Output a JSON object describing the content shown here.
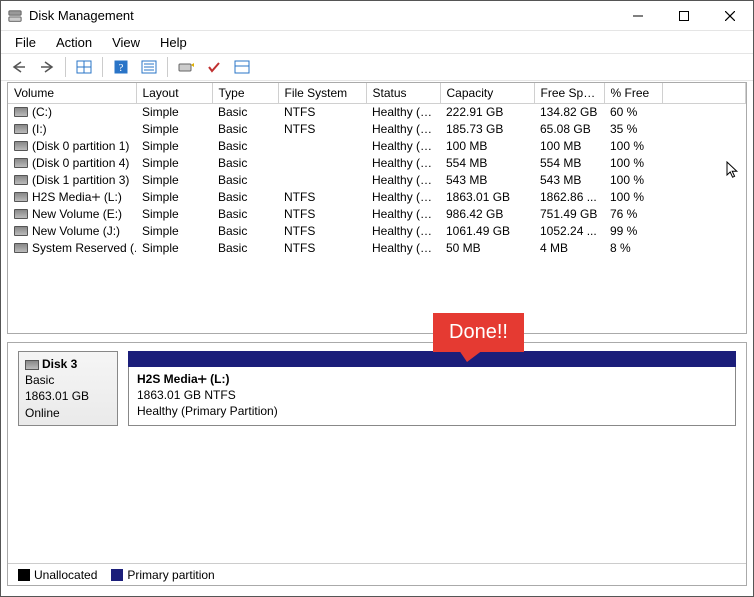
{
  "window": {
    "title": "Disk Management"
  },
  "menus": {
    "file": "File",
    "action": "Action",
    "view": "View",
    "help": "Help"
  },
  "columns": {
    "volume": "Volume",
    "layout": "Layout",
    "type": "Type",
    "fs": "File System",
    "status": "Status",
    "capacity": "Capacity",
    "free": "Free Spa...",
    "pctfree": "% Free"
  },
  "rows": [
    {
      "volume": "(C:)",
      "layout": "Simple",
      "type": "Basic",
      "fs": "NTFS",
      "status": "Healthy (B...",
      "capacity": "222.91 GB",
      "free": "134.82 GB",
      "pct": "60 %"
    },
    {
      "volume": "(I:)",
      "layout": "Simple",
      "type": "Basic",
      "fs": "NTFS",
      "status": "Healthy (P...",
      "capacity": "185.73 GB",
      "free": "65.08 GB",
      "pct": "35 %"
    },
    {
      "volume": "(Disk 0 partition 1)",
      "layout": "Simple",
      "type": "Basic",
      "fs": "",
      "status": "Healthy (E...",
      "capacity": "100 MB",
      "free": "100 MB",
      "pct": "100 %"
    },
    {
      "volume": "(Disk 0 partition 4)",
      "layout": "Simple",
      "type": "Basic",
      "fs": "",
      "status": "Healthy (R...",
      "capacity": "554 MB",
      "free": "554 MB",
      "pct": "100 %"
    },
    {
      "volume": "(Disk 1 partition 3)",
      "layout": "Simple",
      "type": "Basic",
      "fs": "",
      "status": "Healthy (R...",
      "capacity": "543 MB",
      "free": "543 MB",
      "pct": "100 %"
    },
    {
      "volume": "H2S Media🞣 (L:)",
      "layout": "Simple",
      "type": "Basic",
      "fs": "NTFS",
      "status": "Healthy (P...",
      "capacity": "1863.01 GB",
      "free": "1862.86 ...",
      "pct": "100 %"
    },
    {
      "volume": "New Volume (E:)",
      "layout": "Simple",
      "type": "Basic",
      "fs": "NTFS",
      "status": "Healthy (P...",
      "capacity": "986.42 GB",
      "free": "751.49 GB",
      "pct": "76 %"
    },
    {
      "volume": "New Volume (J:)",
      "layout": "Simple",
      "type": "Basic",
      "fs": "NTFS",
      "status": "Healthy (P...",
      "capacity": "1061.49 GB",
      "free": "1052.24 ...",
      "pct": "99 %"
    },
    {
      "volume": "System Reserved (...",
      "layout": "Simple",
      "type": "Basic",
      "fs": "NTFS",
      "status": "Healthy (A...",
      "capacity": "50 MB",
      "free": "4 MB",
      "pct": "8 %"
    }
  ],
  "disk": {
    "name": "Disk 3",
    "type": "Basic",
    "size": "1863.01 GB",
    "state": "Online",
    "partition": {
      "title": "H2S Media🞣  (L:)",
      "size_fs": "1863.01 GB NTFS",
      "status": "Healthy (Primary Partition)"
    }
  },
  "legend": {
    "unallocated": "Unallocated",
    "primary": "Primary partition"
  },
  "callout": "Done!!"
}
